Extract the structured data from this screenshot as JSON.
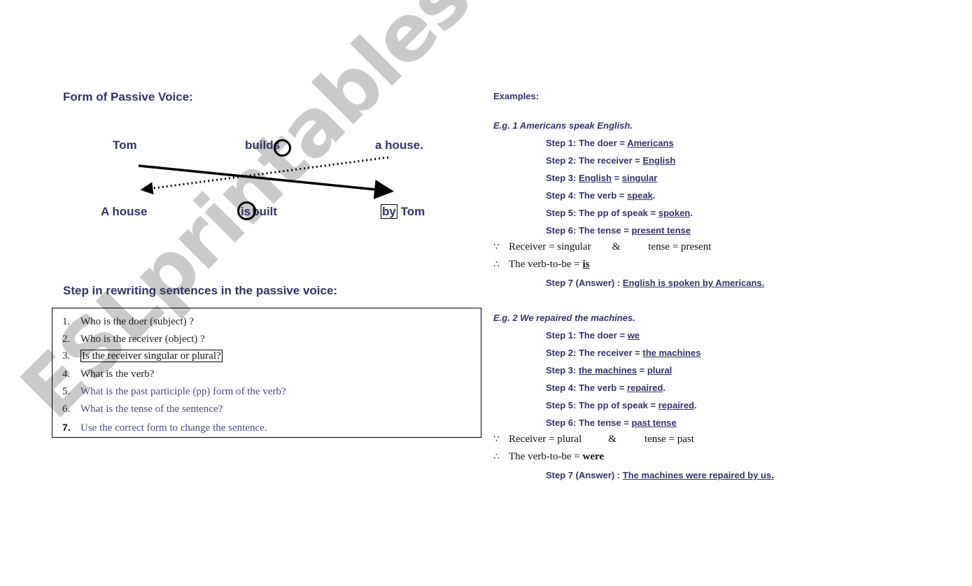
{
  "left": {
    "form_heading": "Form of Passive Voice:",
    "diagram": {
      "active": {
        "subject": "Tom",
        "verb": "builds",
        "object": "a house."
      },
      "passive": {
        "subject": "A house",
        "be_verb": "is",
        "participle": "built",
        "by": "by",
        "agent": "Tom"
      },
      "arrows": [
        {
          "style": "solid",
          "from": "Tom",
          "to": "by Tom"
        },
        {
          "style": "dotted",
          "from": "a house.",
          "to": "A house"
        }
      ]
    },
    "steps_heading": "Step in rewriting sentences in the passive voice:",
    "steps": [
      {
        "num": "1.",
        "text": "Who is the doer (subject) ?"
      },
      {
        "num": "2.",
        "text": "Who is the receiver (object) ?"
      },
      {
        "num": "3.",
        "text": "Is the receiver singular or plural?"
      },
      {
        "num": "4.",
        "text": "What is the verb?"
      },
      {
        "num": "5.",
        "text": "What is the past participle (pp) form of the verb?"
      },
      {
        "num": "6.",
        "text": "What is the tense of the sentence?"
      },
      {
        "num": "7.",
        "text": "Use the correct form to change the sentence."
      }
    ]
  },
  "right": {
    "examples_heading": "Examples:",
    "examples": [
      {
        "title": "E.g. 1 Americans speak English.",
        "step1": {
          "label": "Step 1: The doer = ",
          "value": "Americans"
        },
        "step2": {
          "label": "Step 2: The receiver = ",
          "value": "English"
        },
        "step3": {
          "label": "Step 3: ",
          "subject": "English",
          "eq": " = ",
          "value": "singular"
        },
        "step4": {
          "label": "Step 4: The verb = ",
          "value": "speak",
          "end": "."
        },
        "step5": {
          "label": "Step 5: The pp of speak = ",
          "value": "spoken",
          "end": "."
        },
        "step6": {
          "label": "Step 6: The tense = ",
          "value": "present tense"
        },
        "because": {
          "symbol": "∵",
          "left": "Receiver = singular",
          "amp": "&",
          "right": "tense = present"
        },
        "therefore": {
          "symbol": "∴",
          "text": "The verb-to-be = ",
          "value": "is"
        },
        "step7": {
          "label": "Step 7 (Answer) : ",
          "value": "English is spoken by Americans."
        }
      },
      {
        "title": "E.g. 2 We repaired the machines.",
        "step1": {
          "label": "Step 1: The doer = ",
          "value": "we"
        },
        "step2": {
          "label": "Step 2: The receiver = ",
          "value": "the machines"
        },
        "step3": {
          "label": "Step 3: ",
          "subject": "the machines",
          "eq": " = ",
          "value": "plural"
        },
        "step4": {
          "label": "Step 4: The verb = ",
          "value": "repaired",
          "end": "."
        },
        "step5": {
          "label": "Step 5: The pp of speak = ",
          "value": "repaired",
          "end": "."
        },
        "step6": {
          "label": "Step 6: The tense = ",
          "value": "past tense"
        },
        "because": {
          "symbol": "∵",
          "left": "Receiver = plural",
          "amp": "&",
          "right": "tense = past"
        },
        "therefore": {
          "symbol": "∴",
          "text": "The verb-to-be = ",
          "value": "were"
        },
        "step7": {
          "label": "Step 7 (Answer) : ",
          "value": "The machines were repaired by us."
        }
      }
    ]
  },
  "watermark": "ESLprintables.com",
  "colors": {
    "text_primary": "#333366",
    "watermark": "#c8c8c8"
  }
}
